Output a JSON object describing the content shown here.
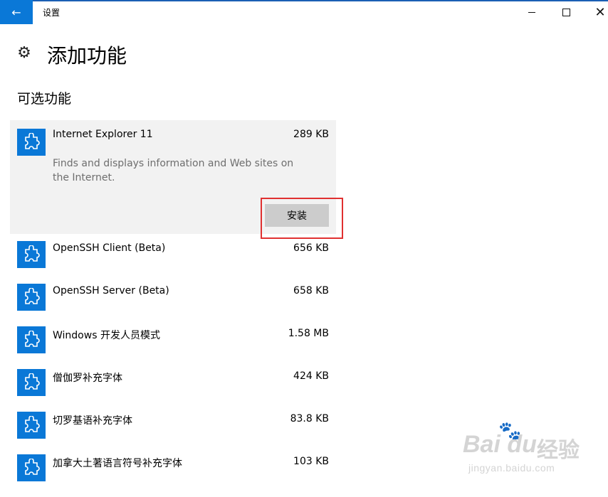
{
  "window": {
    "title": "设置",
    "back_glyph": "←",
    "close_glyph": "✕"
  },
  "page": {
    "title": "添加功能",
    "section_title": "可选功能"
  },
  "expanded_feature": {
    "name": "Internet Explorer 11",
    "size": "289 KB",
    "description": "Finds and displays information and Web sites on the Internet.",
    "install_label": "安装"
  },
  "features": [
    {
      "name": "OpenSSH Client (Beta)",
      "size": "656 KB"
    },
    {
      "name": "OpenSSH Server (Beta)",
      "size": "658 KB"
    },
    {
      "name": "Windows 开发人员模式",
      "size": "1.58 MB"
    },
    {
      "name": "僧伽罗补充字体",
      "size": "424 KB"
    },
    {
      "name": "切罗基语补充字体",
      "size": "83.8 KB"
    },
    {
      "name": "加拿大土著语言符号补充字体",
      "size": "103 KB"
    }
  ],
  "watermark": {
    "logo": "Bai du",
    "brand": "经验",
    "url": "jingyan.baidu.com"
  },
  "colors": {
    "accent": "#0a78d7",
    "expanded_bg": "#f2f2f2",
    "install_btn_bg": "#cccccc",
    "highlight": "#e03030"
  },
  "icons": {
    "back": "arrow-left-icon",
    "settings": "gear-icon",
    "feature": "puzzle-piece-icon"
  }
}
